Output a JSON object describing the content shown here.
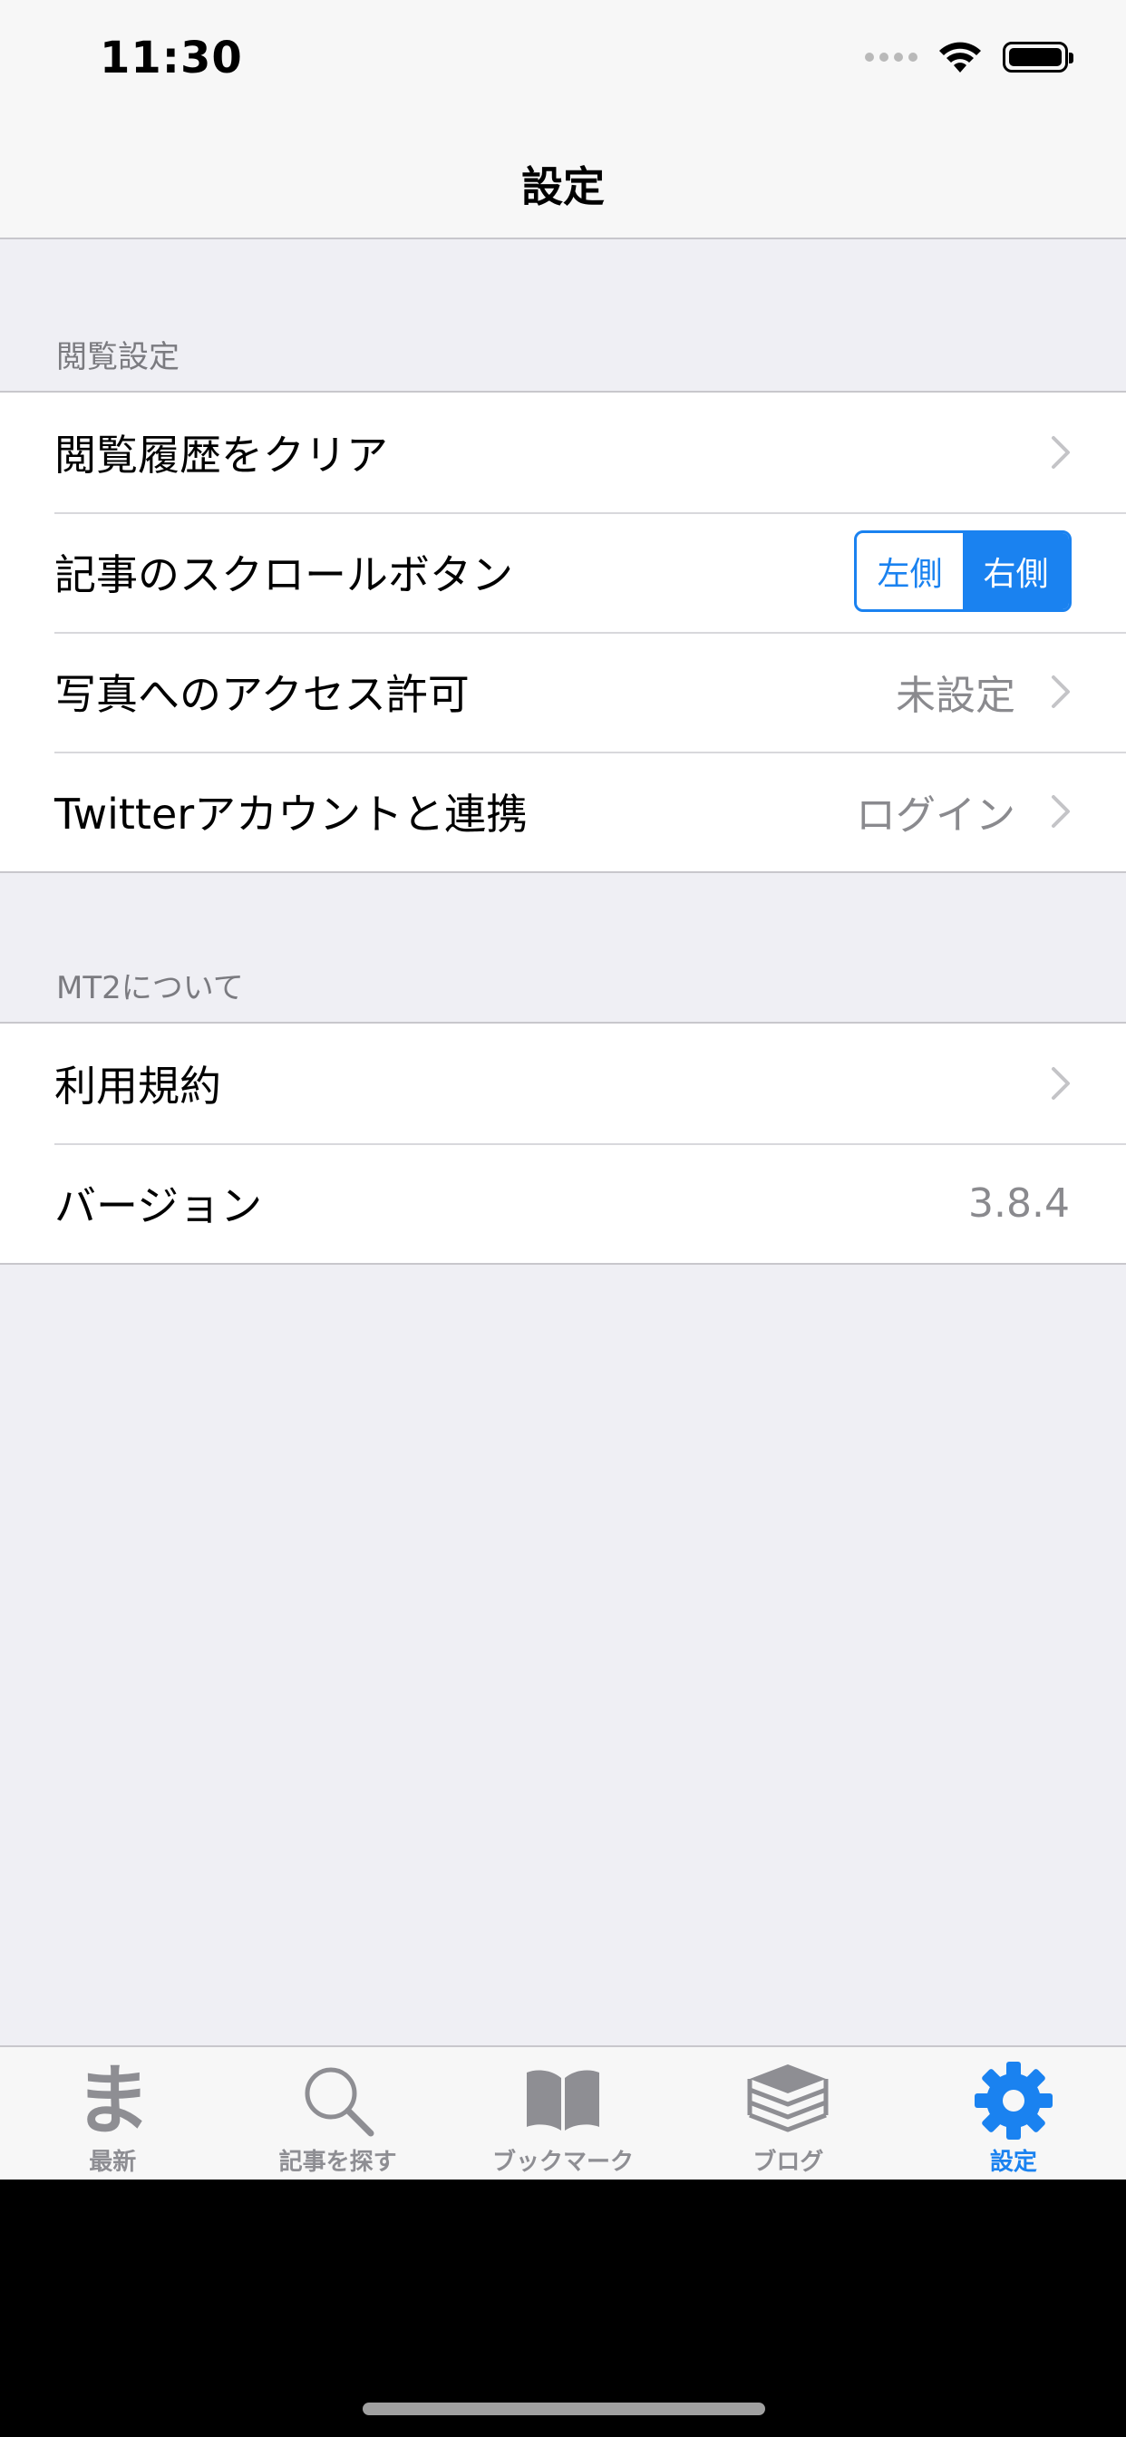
{
  "status_bar": {
    "time": "11:30"
  },
  "nav": {
    "title": "設定"
  },
  "sections": [
    {
      "header": "閲覧設定",
      "rows": [
        {
          "label": "閲覧履歴をクリア"
        },
        {
          "label": "記事のスクロールボタン",
          "segments": [
            "左側",
            "右側"
          ],
          "selected": "右側"
        },
        {
          "label": "写真へのアクセス許可",
          "value": "未設定"
        },
        {
          "label": "Twitterアカウントと連携",
          "value": "ログイン"
        }
      ]
    },
    {
      "header": "MT2について",
      "rows": [
        {
          "label": "利用規約"
        },
        {
          "label": "バージョン",
          "value": "3.8.4"
        }
      ]
    }
  ],
  "tabs": [
    {
      "label": "最新",
      "icon": "ma-logo-icon",
      "glyph": "ま"
    },
    {
      "label": "記事を探す",
      "icon": "search-icon"
    },
    {
      "label": "ブックマーク",
      "icon": "book-icon"
    },
    {
      "label": "ブログ",
      "icon": "stack-icon"
    },
    {
      "label": "設定",
      "icon": "gear-icon",
      "active": true
    }
  ],
  "colors": {
    "accent": "#1a82f0",
    "inactive": "#8e8e93",
    "background": "#efeff4"
  }
}
